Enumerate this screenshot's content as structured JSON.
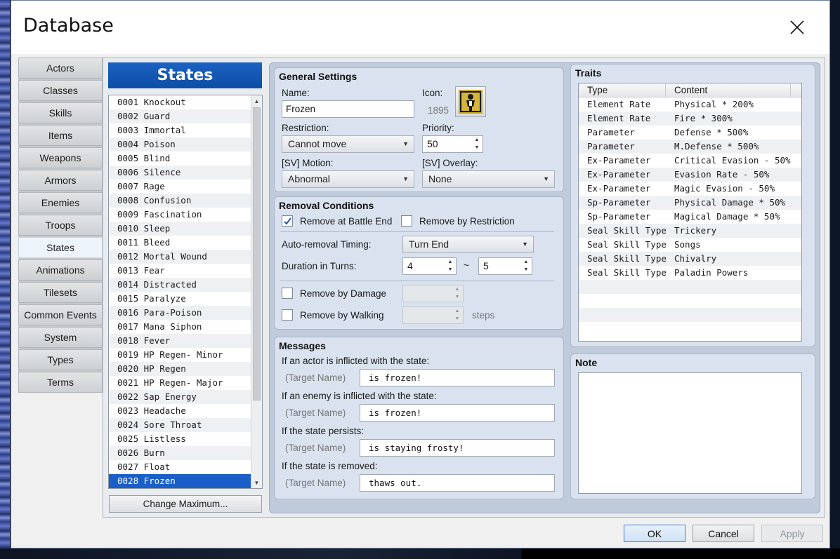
{
  "window": {
    "title": "Database"
  },
  "categories": [
    "Actors",
    "Classes",
    "Skills",
    "Items",
    "Weapons",
    "Armors",
    "Enemies",
    "Troops",
    "States",
    "Animations",
    "Tilesets",
    "Common Events",
    "System",
    "Types",
    "Terms"
  ],
  "active_category": "States",
  "list": {
    "header": "States",
    "items": [
      "0001 Knockout",
      "0002 Guard",
      "0003 Immortal",
      "0004 Poison",
      "0005 Blind",
      "0006 Silence",
      "0007 Rage",
      "0008 Confusion",
      "0009 Fascination",
      "0010 Sleep",
      "0011 Bleed",
      "0012 Mortal Wound",
      "0013 Fear",
      "0014 Distracted",
      "0015 Paralyze",
      "0016 Para-Poison",
      "0017 Mana Siphon",
      "0018 Fever",
      "0019 HP Regen- Minor",
      "0020 HP Regen",
      "0021 HP Regen- Major",
      "0022 Sap Energy",
      "0023 Headache",
      "0024 Sore Throat",
      "0025 Listless",
      "0026 Burn",
      "0027 Float",
      "0028 Frozen"
    ],
    "selected_index": 27,
    "change_max_label": "Change Maximum..."
  },
  "general": {
    "title": "General Settings",
    "name_label": "Name:",
    "name_value": "Frozen",
    "icon_label": "Icon:",
    "icon_index": "1895",
    "restriction_label": "Restriction:",
    "restriction_value": "Cannot move",
    "priority_label": "Priority:",
    "priority_value": "50",
    "motion_label": "[SV] Motion:",
    "motion_value": "Abnormal",
    "overlay_label": "[SV] Overlay:",
    "overlay_value": "None"
  },
  "removal": {
    "title": "Removal Conditions",
    "battle_end_label": "Remove at Battle End",
    "battle_end_checked": true,
    "restriction_label": "Remove by Restriction",
    "restriction_checked": false,
    "timing_label": "Auto-removal Timing:",
    "timing_value": "Turn End",
    "duration_label": "Duration in Turns:",
    "duration_min": "4",
    "tilde": "~",
    "duration_max": "5",
    "damage_label": "Remove by Damage",
    "damage_checked": false,
    "walking_label": "Remove by Walking",
    "walking_checked": false,
    "steps_label": "steps"
  },
  "messages": {
    "title": "Messages",
    "target_placeholder": "(Target Name)",
    "items": [
      {
        "label": "If an actor is inflicted with the state:",
        "value": "is frozen!"
      },
      {
        "label": "If an enemy is inflicted with the state:",
        "value": "is frozen!"
      },
      {
        "label": "If the state persists:",
        "value": "is staying frosty!"
      },
      {
        "label": "If the state is removed:",
        "value": "thaws out."
      }
    ]
  },
  "traits": {
    "title": "Traits",
    "columns": [
      "Type",
      "Content"
    ],
    "rows": [
      [
        "Element Rate",
        "Physical * 200%"
      ],
      [
        "Element Rate",
        "Fire * 300%"
      ],
      [
        "Parameter",
        "Defense * 500%"
      ],
      [
        "Parameter",
        "M.Defense * 500%"
      ],
      [
        "Ex-Parameter",
        "Critical Evasion - 50%"
      ],
      [
        "Ex-Parameter",
        "Evasion Rate - 50%"
      ],
      [
        "Ex-Parameter",
        "Magic Evasion - 50%"
      ],
      [
        "Sp-Parameter",
        "Physical Damage * 50%"
      ],
      [
        "Sp-Parameter",
        "Magical Damage * 50%"
      ],
      [
        "Seal Skill Type",
        "Trickery"
      ],
      [
        "Seal Skill Type",
        "Songs"
      ],
      [
        "Seal Skill Type",
        "Chivalry"
      ],
      [
        "Seal Skill Type",
        "Paladin Powers"
      ]
    ]
  },
  "note": {
    "title": "Note",
    "value": ""
  },
  "footer": {
    "ok": "OK",
    "cancel": "Cancel",
    "apply": "Apply"
  },
  "colors": {
    "accent": "#1a5fc8",
    "header_blue": "#0d4ea6",
    "panel": "#d9e2ee"
  },
  "icons": {
    "close": "close-icon",
    "state_icon": "frozen-figure-icon",
    "check": "check-icon"
  }
}
